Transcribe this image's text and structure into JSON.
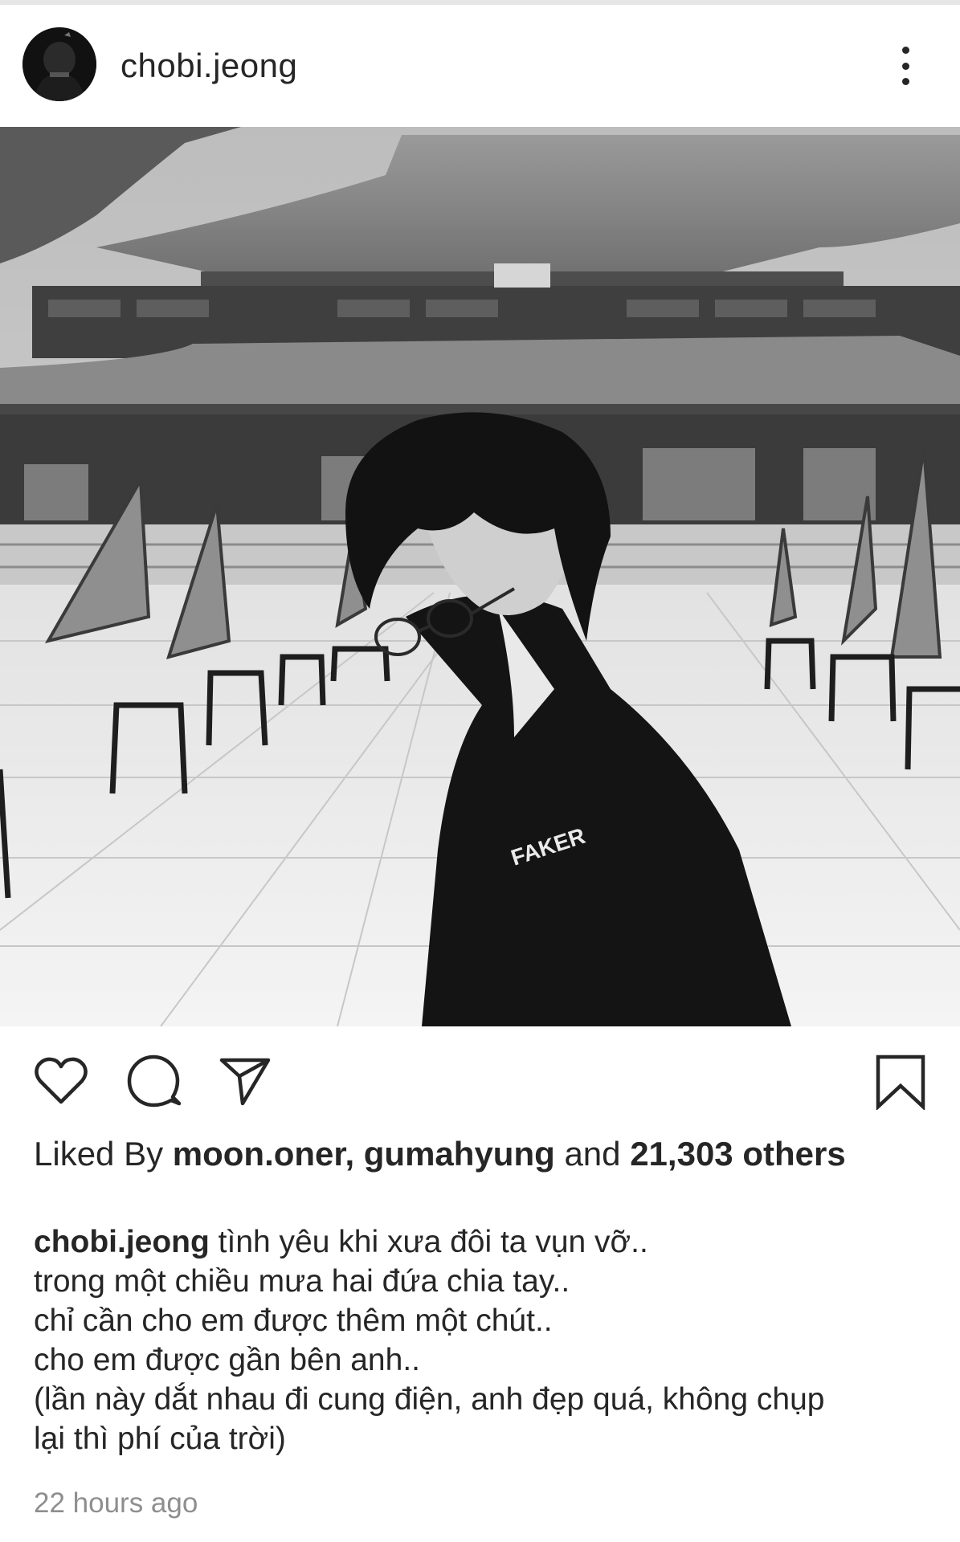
{
  "post": {
    "username": "chobi.jeong",
    "avatar_icon": "profile-avatar",
    "more_icon": "more-vertical-icon",
    "photo_alt": "",
    "photo_shirt_text": "FAKER"
  },
  "actions": {
    "like_icon": "heart-icon",
    "comment_icon": "comment-icon",
    "share_icon": "send-icon",
    "save_icon": "bookmark-icon"
  },
  "likes": {
    "prefix": "Liked By",
    "users": "moon.oner, gumahyung",
    "joiner": "and",
    "count": "21,303",
    "suffix": "others"
  },
  "caption": {
    "username": "chobi.jeong",
    "lines": [
      "tình yêu khi xưa đôi ta vụn vỡ..",
      "trong một chiều mưa hai đứa chia tay..",
      "chỉ cần cho em được thêm một chút..",
      "cho em được gần bên anh..",
      "(lần này dắt nhau đi cung điện, anh đẹp quá, không chụp",
      "lại thì phí của trời)"
    ]
  },
  "timestamp": "22 hours ago",
  "colors": {
    "text": "#262626",
    "muted": "#8e8e8e",
    "background": "#ffffff"
  }
}
